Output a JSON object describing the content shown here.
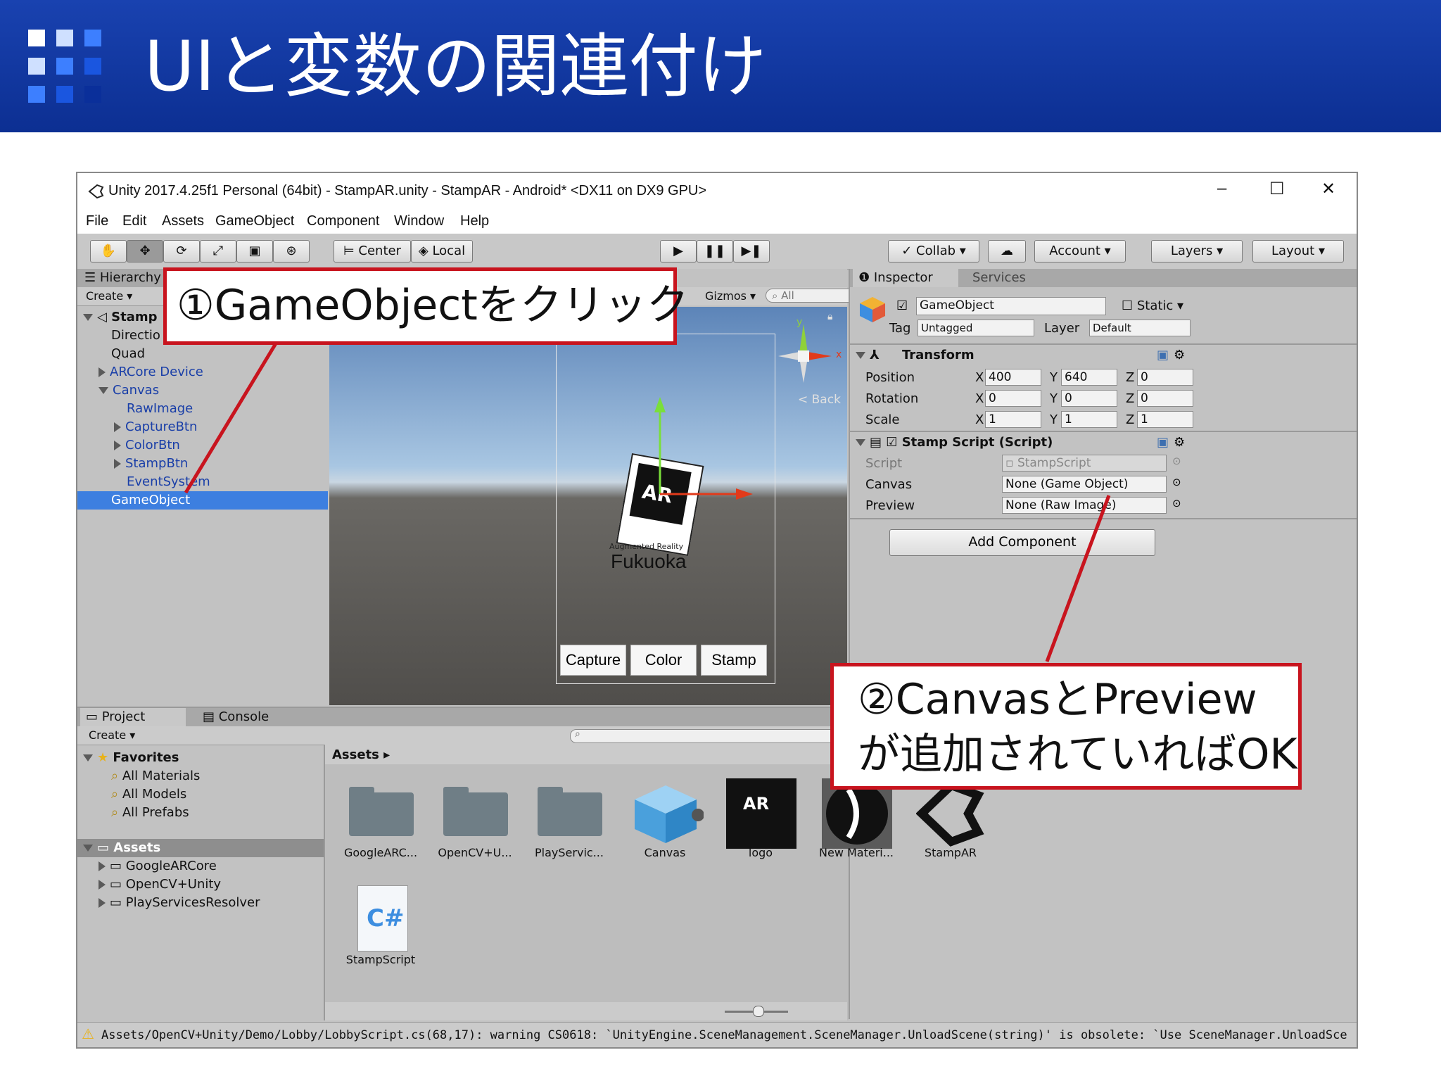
{
  "slide": {
    "title": "UIと変数の関連付け"
  },
  "window": {
    "title": "Unity 2017.4.25f1 Personal (64bit) - StampAR.unity - StampAR - Android* <DX11 on DX9 GPU>",
    "controls": {
      "minimize": "–",
      "maximize": "☐",
      "close": "✕"
    },
    "menu": [
      "File",
      "Edit",
      "Assets",
      "GameObject",
      "Component",
      "Window",
      "Help"
    ]
  },
  "toolbar": {
    "pivot": "Center",
    "space": "Local",
    "collab": "Collab",
    "account": "Account",
    "layers": "Layers",
    "layout": "Layout"
  },
  "hierarchy": {
    "tab": "Hierarchy",
    "create": "Create",
    "scene": "Stamp",
    "items": [
      "Directio",
      "Quad",
      "ARCore Device",
      "Canvas",
      "RawImage",
      "CaptureBtn",
      "ColorBtn",
      "StampBtn",
      "EventSystem",
      "GameObject"
    ]
  },
  "scene": {
    "gizmos": "Gizmos",
    "search_placeholder": "All",
    "back_label": "< Back",
    "gizmo_y": "y",
    "gizmo_x": "x",
    "buttons": [
      "Capture",
      "Color",
      "Stamp"
    ],
    "marker_text": "AR",
    "marker_sub": "Augmented Reality",
    "marker_city": "Fukuoka"
  },
  "inspector": {
    "tab": "Inspector",
    "tab2": "Services",
    "object_name": "GameObject",
    "static": "Static",
    "tag_label": "Tag",
    "tag_value": "Untagged",
    "layer_label": "Layer",
    "layer_value": "Default",
    "transform": {
      "title": "Transform",
      "rows": [
        {
          "label": "Position",
          "x": "400",
          "y": "640",
          "z": "0"
        },
        {
          "label": "Rotation",
          "x": "0",
          "y": "0",
          "z": "0"
        },
        {
          "label": "Scale",
          "x": "1",
          "y": "1",
          "z": "1"
        }
      ]
    },
    "script": {
      "title": "Stamp Script (Script)",
      "script_label": "Script",
      "script_value": "StampScript",
      "canvas_label": "Canvas",
      "canvas_value": "None (Game Object)",
      "preview_label": "Preview",
      "preview_value": "None (Raw Image)"
    },
    "add_component": "Add Component"
  },
  "project": {
    "tab": "Project",
    "tab2": "Console",
    "create": "Create",
    "favorites": "Favorites",
    "favorite_items": [
      "All Materials",
      "All Models",
      "All Prefabs"
    ],
    "assets_root": "Assets",
    "asset_folders": [
      "GoogleARCore",
      "OpenCV+Unity",
      "PlayServicesResolver"
    ],
    "breadcrumb": "Assets",
    "assets": [
      "GoogleARC...",
      "OpenCV+U...",
      "PlayServic...",
      "Canvas",
      "logo",
      "New Materi...",
      "StampAR",
      "StampScript"
    ]
  },
  "status": {
    "warning": "Assets/OpenCV+Unity/Demo/Lobby/LobbyScript.cs(68,17): warning CS0618: `UnityEngine.SceneManagement.SceneManager.UnloadScene(string)' is obsolete: `Use SceneManager.UnloadSce"
  },
  "callouts": {
    "one": "①GameObjectをクリック",
    "two_line1": "②CanvasとPreview",
    "two_line2": "が追加されていればOK"
  },
  "colors": {
    "header": "#1237a4",
    "callout_border": "#c8141e",
    "selection": "#3d7fe0"
  }
}
